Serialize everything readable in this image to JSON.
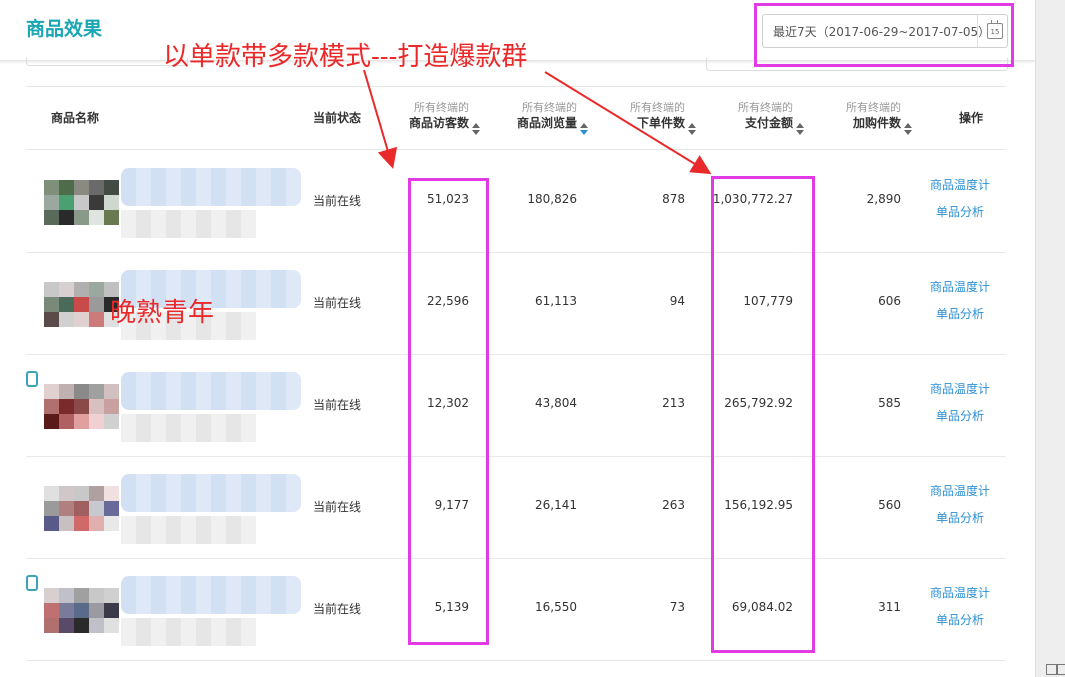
{
  "page": {
    "title": "商品效果"
  },
  "date_picker": {
    "label": "最近7天（2017-06-29~2017-07-05）",
    "icon_text": "15"
  },
  "annotations": {
    "headline": "以单款带多款模式---打造爆款群",
    "watermark": "晚熟青年"
  },
  "table": {
    "columns": {
      "product_name": "商品名称",
      "status": "当前状态",
      "visitors_sub": "所有终端的",
      "visitors": "商品访客数",
      "pageviews_sub": "所有终端的",
      "pageviews": "商品浏览量",
      "orders_sub": "所有终端的",
      "orders": "下单件数",
      "payment_sub": "所有终端的",
      "payment": "支付金额",
      "cart_sub": "所有终端的",
      "cart": "加购件数",
      "actions": "操作"
    },
    "rows": [
      {
        "status": "当前在线",
        "visitors": "51,023",
        "pageviews": "180,826",
        "orders": "878",
        "payment": "1,030,772.27",
        "cart": "2,890",
        "action1": "商品温度计",
        "action2": "单品分析"
      },
      {
        "status": "当前在线",
        "visitors": "22,596",
        "pageviews": "61,113",
        "orders": "94",
        "payment": "107,779",
        "cart": "606",
        "action1": "商品温度计",
        "action2": "单品分析"
      },
      {
        "status": "当前在线",
        "visitors": "12,302",
        "pageviews": "43,804",
        "orders": "213",
        "payment": "265,792.92",
        "cart": "585",
        "action1": "商品温度计",
        "action2": "单品分析"
      },
      {
        "status": "当前在线",
        "visitors": "9,177",
        "pageviews": "26,141",
        "orders": "263",
        "payment": "156,192.95",
        "cart": "560",
        "action1": "商品温度计",
        "action2": "单品分析"
      },
      {
        "status": "当前在线",
        "visitors": "5,139",
        "pageviews": "16,550",
        "orders": "73",
        "payment": "69,084.02",
        "cart": "311",
        "action1": "商品温度计",
        "action2": "单品分析"
      }
    ]
  },
  "colors": {
    "brand": "#1aa6b2",
    "link": "#2b8fd4",
    "highlight": "#e23be6",
    "annotation": "#ea2a2a"
  },
  "icons": {
    "calendar": "calendar-icon",
    "sort": "sort-arrows-icon",
    "checkbox": "checkbox-icon"
  }
}
